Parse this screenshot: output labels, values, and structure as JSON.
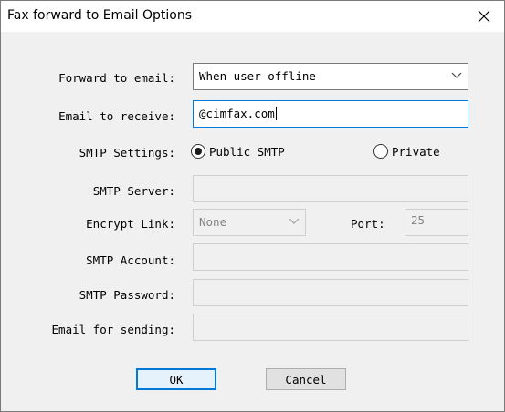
{
  "window": {
    "title": "Fax forward to Email Options",
    "close_icon": "close-icon"
  },
  "form": {
    "forward_label": "Forward to email:",
    "forward_value": "When user offline",
    "receive_label": "Email to receive:",
    "receive_value": "@cimfax.com",
    "smtp_settings_label": "SMTP Settings:",
    "smtp_public_label": "Public SMTP",
    "smtp_private_label": "Private",
    "smtp_selected": "Public SMTP",
    "smtp_server_label": "SMTP Server:",
    "smtp_server_value": "",
    "encrypt_label": "Encrypt Link:",
    "encrypt_value": "None",
    "port_label": "Port:",
    "port_value": "25",
    "smtp_account_label": "SMTP Account:",
    "smtp_account_value": "",
    "smtp_password_label": "SMTP Password:",
    "smtp_password_value": "",
    "sending_email_label": "Email for sending:",
    "sending_email_value": ""
  },
  "buttons": {
    "ok_label": "OK",
    "cancel_label": "Cancel"
  },
  "colors": {
    "accent": "#0078d7",
    "dialog_bg": "#f0f0f0"
  }
}
